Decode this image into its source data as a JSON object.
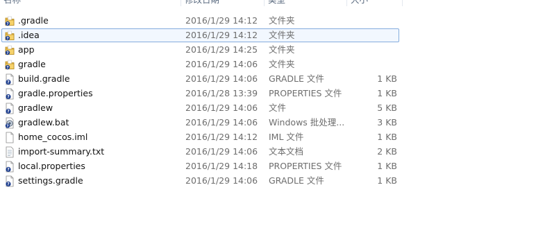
{
  "columns": {
    "name": "名称",
    "date": "修改日期",
    "type": "类型",
    "size": "大小"
  },
  "files": [
    {
      "name": ".gradle",
      "date": "2016/1/29 14:12",
      "type": "文件夹",
      "size": "",
      "icon": "folder-icon",
      "selected": false
    },
    {
      "name": ".idea",
      "date": "2016/1/29 14:12",
      "type": "文件夹",
      "size": "",
      "icon": "folder-icon",
      "selected": true
    },
    {
      "name": "app",
      "date": "2016/1/29 14:25",
      "type": "文件夹",
      "size": "",
      "icon": "folder-icon",
      "selected": false
    },
    {
      "name": "gradle",
      "date": "2016/1/29 14:06",
      "type": "文件夹",
      "size": "",
      "icon": "folder-icon",
      "selected": false
    },
    {
      "name": "build.gradle",
      "date": "2016/1/29 14:06",
      "type": "GRADLE 文件",
      "size": "1 KB",
      "icon": "unknown-file-icon",
      "selected": false
    },
    {
      "name": "gradle.properties",
      "date": "2016/1/28 13:39",
      "type": "PROPERTIES 文件",
      "size": "1 KB",
      "icon": "unknown-file-icon",
      "selected": false
    },
    {
      "name": "gradlew",
      "date": "2016/1/29 14:06",
      "type": "文件",
      "size": "5 KB",
      "icon": "unknown-file-icon",
      "selected": false
    },
    {
      "name": "gradlew.bat",
      "date": "2016/1/29 14:06",
      "type": "Windows 批处理...",
      "size": "3 KB",
      "icon": "batch-file-icon",
      "selected": false
    },
    {
      "name": "home_cocos.iml",
      "date": "2016/1/29 14:12",
      "type": "IML 文件",
      "size": "1 KB",
      "icon": "blank-file-icon",
      "selected": false
    },
    {
      "name": "import-summary.txt",
      "date": "2016/1/29 14:06",
      "type": "文本文档",
      "size": "2 KB",
      "icon": "text-file-icon",
      "selected": false
    },
    {
      "name": "local.properties",
      "date": "2016/1/29 14:18",
      "type": "PROPERTIES 文件",
      "size": "1 KB",
      "icon": "unknown-file-icon",
      "selected": false
    },
    {
      "name": "settings.gradle",
      "date": "2016/1/29 14:06",
      "type": "GRADLE 文件",
      "size": "1 KB",
      "icon": "unknown-file-icon",
      "selected": false
    }
  ]
}
